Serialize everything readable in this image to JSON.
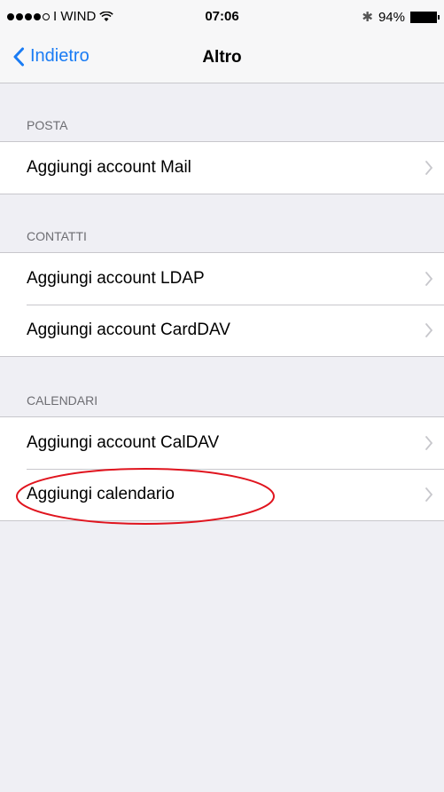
{
  "status_bar": {
    "carrier": "I WIND",
    "time": "07:06",
    "battery": "94%"
  },
  "nav": {
    "back_label": "Indietro",
    "title": "Altro"
  },
  "sections": [
    {
      "header": "POSTA",
      "items": [
        "Aggiungi account Mail"
      ]
    },
    {
      "header": "CONTATTI",
      "items": [
        "Aggiungi account LDAP",
        "Aggiungi account CardDAV"
      ]
    },
    {
      "header": "CALENDARI",
      "items": [
        "Aggiungi account CalDAV",
        "Aggiungi calendario"
      ]
    }
  ],
  "colors": {
    "accent": "#1a7cf4",
    "highlight": "#e0141e",
    "background": "#efeff4"
  }
}
